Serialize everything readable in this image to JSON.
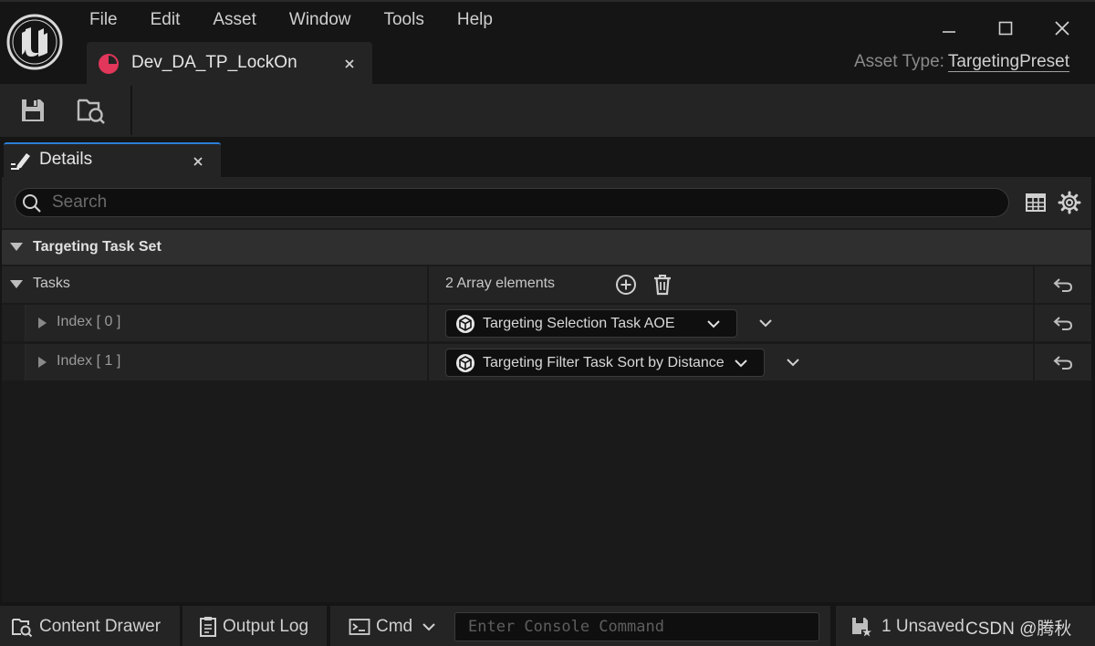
{
  "menu": {
    "items": [
      "File",
      "Edit",
      "Asset",
      "Window",
      "Tools",
      "Help"
    ]
  },
  "asset_tab": {
    "label": "Dev_DA_TP_LockOn",
    "icon": "data-asset-icon",
    "icon_color": "#e2365a"
  },
  "asset_type": {
    "label": "Asset Type:",
    "value": "TargetingPreset"
  },
  "details": {
    "tab_label": "Details",
    "search_placeholder": "Search",
    "category": "Targeting Task Set",
    "tasks": {
      "label": "Tasks",
      "summary": "2 Array elements",
      "elements": [
        {
          "label": "Index [ 0 ]",
          "value": "Targeting Selection Task AOE"
        },
        {
          "label": "Index [ 1 ]",
          "value": "Targeting Filter Task Sort by Distance"
        }
      ]
    }
  },
  "statusbar": {
    "content_drawer": "Content Drawer",
    "output_log": "Output Log",
    "cmd": "Cmd",
    "console_placeholder": "Enter Console Command",
    "unsaved": "1 Unsaved",
    "watermark": "CSDN @腾秋"
  },
  "colors": {
    "accent": "#2b7fd8",
    "background": "#151515",
    "panel": "#242424"
  }
}
